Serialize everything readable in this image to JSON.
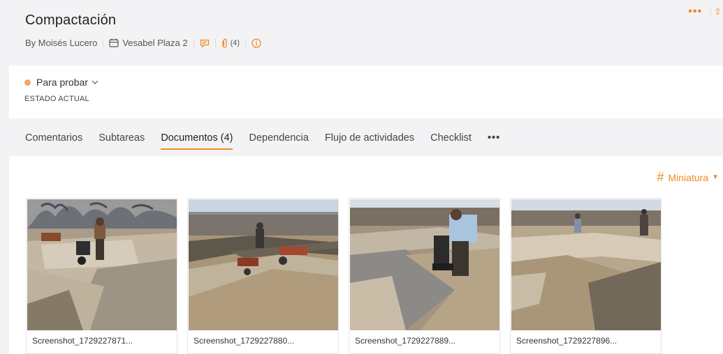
{
  "header": {
    "title": "Compactación",
    "author": "By Moisés Lucero",
    "project": "Vesabel Plaza 2",
    "attachments_count": "(4)"
  },
  "status": {
    "value": "Para probar",
    "label": "ESTADO ACTUAL",
    "dot_color": "#f0a668"
  },
  "tabs": [
    {
      "label": "Comentarios"
    },
    {
      "label": "Subtareas"
    },
    {
      "label": "Documentos (4)"
    },
    {
      "label": "Dependencia"
    },
    {
      "label": "Flujo de actividades"
    },
    {
      "label": "Checklist"
    },
    {
      "label": "•••"
    }
  ],
  "view": {
    "label": "Miniatura"
  },
  "documents": [
    {
      "name": "Screenshot_1729227871..."
    },
    {
      "name": "Screenshot_1729227880..."
    },
    {
      "name": "Screenshot_1729227889..."
    },
    {
      "name": "Screenshot_1729227896..."
    }
  ],
  "colors": {
    "accent": "#f08a24"
  }
}
